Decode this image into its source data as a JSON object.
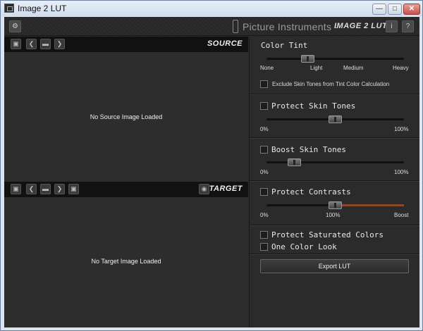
{
  "window": {
    "title": "Image 2 LUT",
    "minimize_glyph": "—",
    "maximize_glyph": "□",
    "close_glyph": "✕"
  },
  "toolbar": {
    "brand": "Picture Instruments -",
    "brand_product": "IMAGE 2 LUT",
    "info_label": "i",
    "help_label": "?"
  },
  "source": {
    "header": "SOURCE",
    "empty_message": "No Source Image Loaded"
  },
  "target": {
    "header": "TARGET",
    "empty_message": "No Target Image Loaded"
  },
  "color_tint": {
    "title": "Color Tint",
    "slider_value": 0.3,
    "ticks": [
      "None",
      "Light",
      "Medium",
      "Heavy"
    ],
    "exclude_skin_label": "Exclude Skin Tones from Tint Color Calculation",
    "exclude_skin_checked": false
  },
  "protect_skin": {
    "label": "Protect Skin Tones",
    "checked": false,
    "slider_value": 50,
    "min_label": "0%",
    "max_label": "100%"
  },
  "boost_skin": {
    "label": "Boost Skin Tones",
    "checked": false,
    "slider_value": 20,
    "min_label": "0%",
    "max_label": "100%"
  },
  "protect_contrasts": {
    "label": "Protect Contrasts",
    "checked": false,
    "slider_value": 100,
    "min_label": "0%",
    "mid_label": "100%",
    "max_label": "Boost"
  },
  "protect_saturated": {
    "label": "Protect Saturated Colors",
    "checked": false
  },
  "one_color_look": {
    "label": "One Color Look",
    "checked": false
  },
  "export": {
    "label": "Export LUT"
  },
  "icons": {
    "settings": "⚙",
    "save": "▣",
    "prev": "❮",
    "folder": "▬",
    "next": "❯",
    "eye": "◉"
  },
  "colors": {
    "panel_bg": "#2b2b2b",
    "header_bg": "#111111",
    "contrast_fill": "#8a4a2a"
  }
}
